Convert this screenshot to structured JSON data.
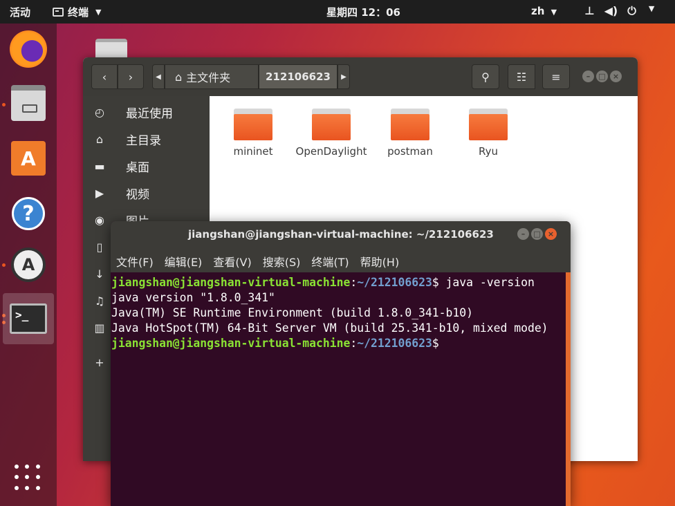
{
  "topbar": {
    "activities": "活动",
    "app_name": "终端",
    "clock": "星期四 12：06",
    "lang": "zh",
    "icons": [
      "network-icon",
      "volume-icon",
      "power-icon"
    ]
  },
  "dock": {
    "apps": [
      "firefox-icon",
      "files-icon",
      "software-icon",
      "help-icon",
      "updater-icon",
      "terminal-icon"
    ],
    "terminal_glyph": ">_"
  },
  "files": {
    "path_home": "主文件夹",
    "path_current": "212106623",
    "sidebar": [
      {
        "label": "最近使用",
        "icon": "clock-icon",
        "glyph": "◴"
      },
      {
        "label": "主目录",
        "icon": "home-icon",
        "glyph": "⌂"
      },
      {
        "label": "桌面",
        "icon": "folder-icon",
        "glyph": "▬"
      },
      {
        "label": "视频",
        "icon": "video-icon",
        "glyph": "▶"
      },
      {
        "label": "图片",
        "icon": "camera-icon",
        "glyph": "◉"
      },
      {
        "label": "",
        "icon": "document-icon",
        "glyph": "▯"
      },
      {
        "label": "",
        "icon": "download-icon",
        "glyph": "↓"
      },
      {
        "label": "",
        "icon": "music-icon",
        "glyph": "♫"
      },
      {
        "label": "",
        "icon": "trash-icon",
        "glyph": "▥"
      },
      {
        "label": "",
        "icon": "plus-icon",
        "glyph": "+"
      }
    ],
    "folders": [
      "mininet",
      "OpenDaylight",
      "postman",
      "Ryu"
    ]
  },
  "terminal": {
    "title": "jiangshan@jiangshan-virtual-machine: ~/212106623",
    "menu": [
      "文件(F)",
      "编辑(E)",
      "查看(V)",
      "搜索(S)",
      "终端(T)",
      "帮助(H)"
    ],
    "prompt_user": "jiangshan@jiangshan-virtual-machine",
    "prompt_path": "~/212106623",
    "command": "$ java -version",
    "output": [
      "java version \"1.8.0_341\"",
      "Java(TM) SE Runtime Environment (build 1.8.0_341-b10)",
      "Java HotSpot(TM) 64-Bit Server VM (build 25.341-b10, mixed mode)"
    ],
    "prompt_end": "$"
  }
}
